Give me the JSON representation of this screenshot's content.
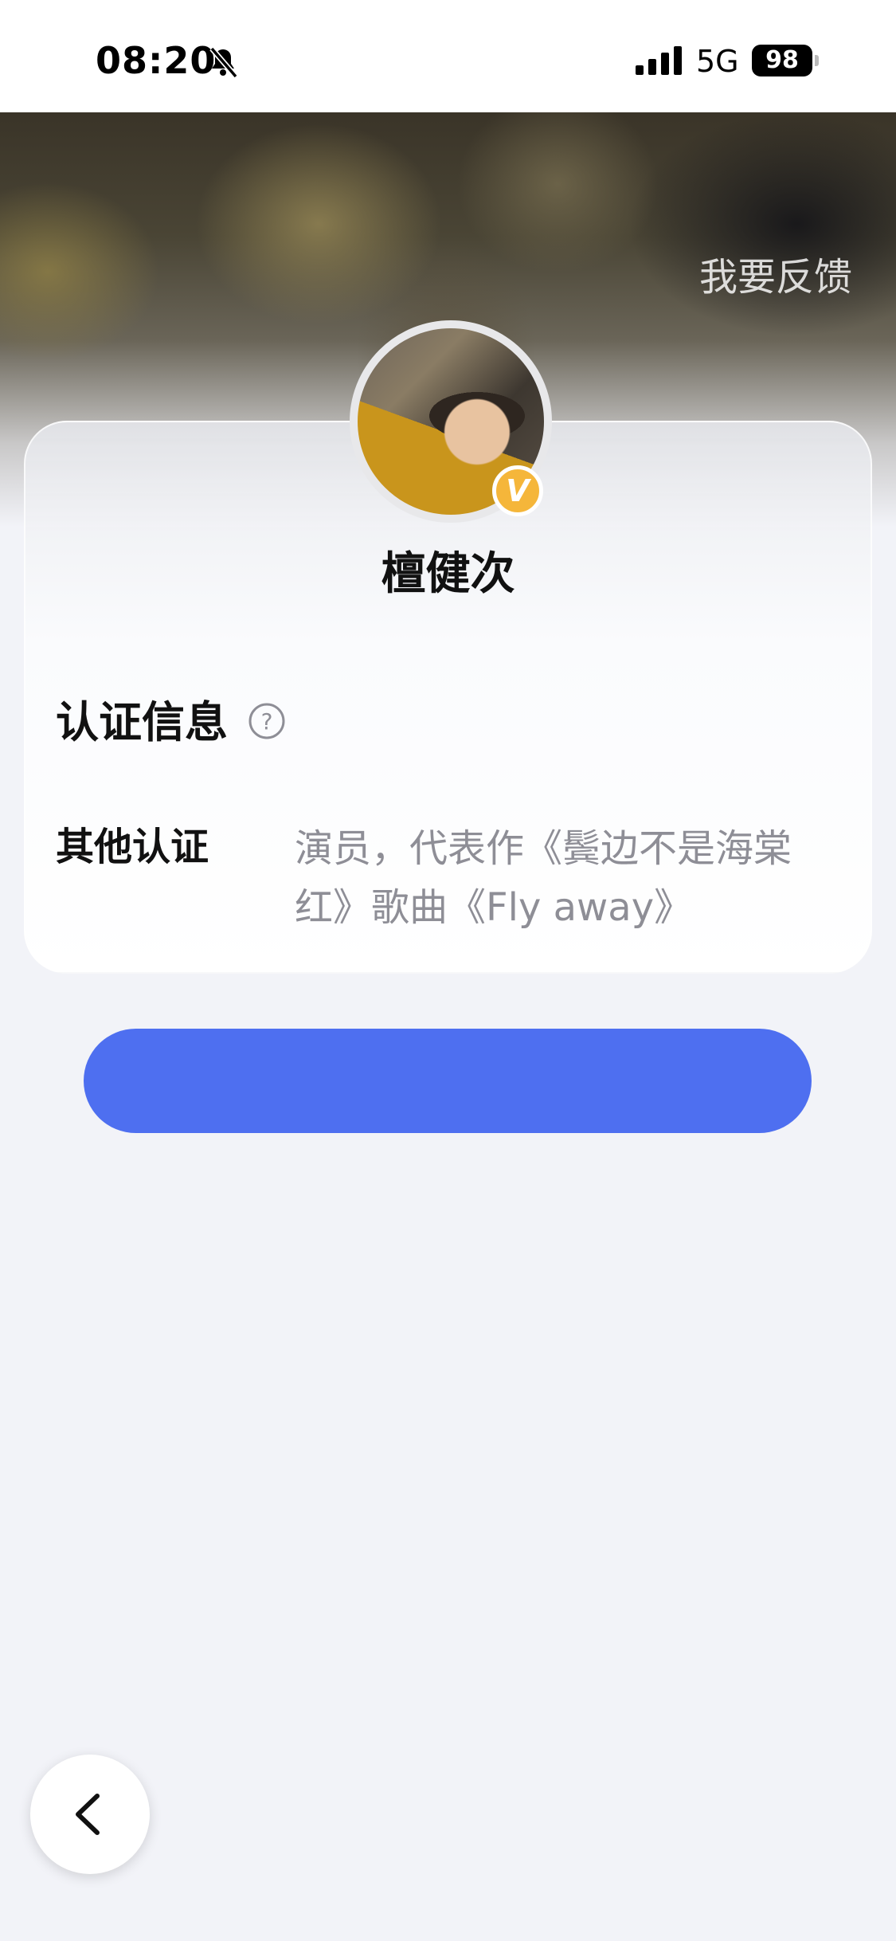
{
  "status_bar": {
    "time": "08:20",
    "network": "5G",
    "battery": "98",
    "icons": [
      "bell-slash-icon",
      "signal-icon"
    ]
  },
  "header": {
    "feedback_label": "我要反馈"
  },
  "profile": {
    "name": "檀健次",
    "verified_badge": "V",
    "badge_color": "#f5b63a"
  },
  "certification": {
    "section_title": "认证信息",
    "help_icon": "question-circle-icon",
    "rows": [
      {
        "label": "其他认证",
        "value": "演员，代表作《鬓边不是海棠红》歌曲《Fly away》"
      }
    ]
  },
  "primary_button": {
    "label": "",
    "color": "#4e6ff0"
  },
  "back_button": {
    "icon": "chevron-left-icon"
  }
}
